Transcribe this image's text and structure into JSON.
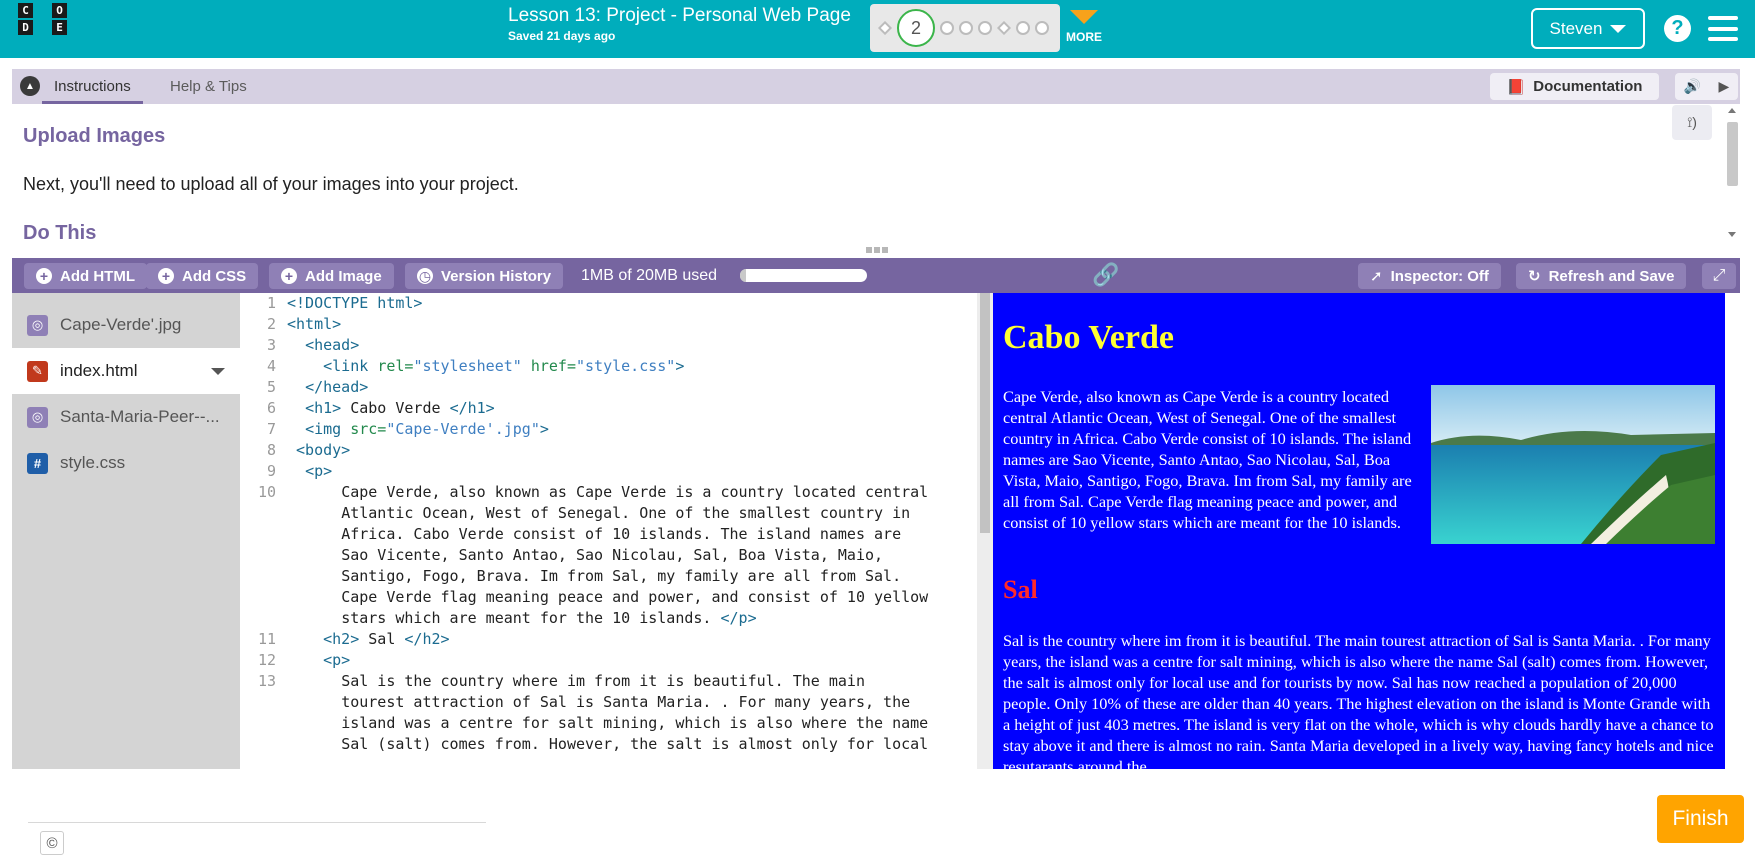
{
  "header": {
    "logo_letters": [
      "C",
      "O",
      "D",
      "E"
    ],
    "lesson_title": "Lesson 13: Project - Personal Web Page",
    "saved_status": "Saved 21 days ago",
    "current_level": "2",
    "more_label": "MORE",
    "user_name": "Steven",
    "help_glyph": "?",
    "colors": {
      "bar": "#00adbc",
      "more_arrow": "#f7a21b",
      "current_ring": "#3bb54a"
    }
  },
  "instructions": {
    "tabs": [
      "Instructions",
      "Help & Tips"
    ],
    "documentation_label": "Documentation",
    "heading": "Upload Images",
    "text": "Next, you'll need to upload all of your images into your project.",
    "subheading": "Do This"
  },
  "toolbar": {
    "add_html": "Add HTML",
    "add_css": "Add CSS",
    "add_image": "Add Image",
    "version_history": "Version History",
    "usage_text": "1MB of 20MB used",
    "usage_fraction": 0.05,
    "inspector": "Inspector: Off",
    "refresh": "Refresh and Save"
  },
  "files": [
    {
      "name": "Cape-Verde'.jpg",
      "type": "image"
    },
    {
      "name": "index.html",
      "type": "html",
      "active": true
    },
    {
      "name": "Santa-Maria-Peer--...",
      "type": "image"
    },
    {
      "name": "style.css",
      "type": "css"
    }
  ],
  "code": {
    "l10_text": [
      "Cape Verde, also known as Cape Verde is a country located central",
      "Atlantic Ocean, West of Senegal. One of the smallest country in",
      "Africa. Cabo Verde consist of 10 islands. The island names are",
      "Sao Vicente, Santo Antao, Sao Nicolau, Sal, Boa Vista, Maio,",
      "Santigo, Fogo, Brava. Im from Sal, my family are all from Sal.",
      "Cape Verde flag meaning peace and power, and consist of 10 yellow",
      "stars which are meant for the 10 islands. "
    ],
    "l13_text": [
      "Sal is the country where im from it is beautiful. The main",
      "tourest attraction of Sal is Santa Maria. . For many years, the",
      "island was a centre for salt mining, which is also where the name",
      "Sal (salt) comes from. However, the salt is almost only for local"
    ]
  },
  "preview": {
    "h1": "Cabo Verde",
    "p1": "Cape Verde, also known as Cape Verde is a country located central Atlantic Ocean, West of Senegal. One of the smallest country in Africa. Cabo Verde consist of 10 islands. The island names are Sao Vicente, Santo Antao, Sao Nicolau, Sal, Boa Vista, Maio, Santigo, Fogo, Brava. Im from Sal, my family are all from Sal. Cape Verde flag meaning peace and power, and consist of 10 yellow stars which are meant for the 10 islands.",
    "h2": "Sal",
    "p2": "Sal is the country where im from it is beautiful. The main tourest attraction of Sal is Santa Maria. . For many years, the island was a centre for salt mining, which is also where the name Sal (salt) comes from. However, the salt is almost only for local use and for tourists by now. Sal has now reached a population of 20,000 people. Only 10% of these are older than 40 years. The highest elevation on the island is Monte Grande with a height of just 403 metres. The island is very flat on the whole, which is why clouds hardly have a chance to stay above it and there is almost no rain. Santa Maria developed in a lively way, having fancy hotels and nice resutarants around the",
    "colors": {
      "background": "#0000ff",
      "h1": "#ffff33",
      "h2": "#ff2a2a"
    }
  },
  "footer": {
    "copyright_glyph": "©",
    "finish_label": "Finish"
  }
}
